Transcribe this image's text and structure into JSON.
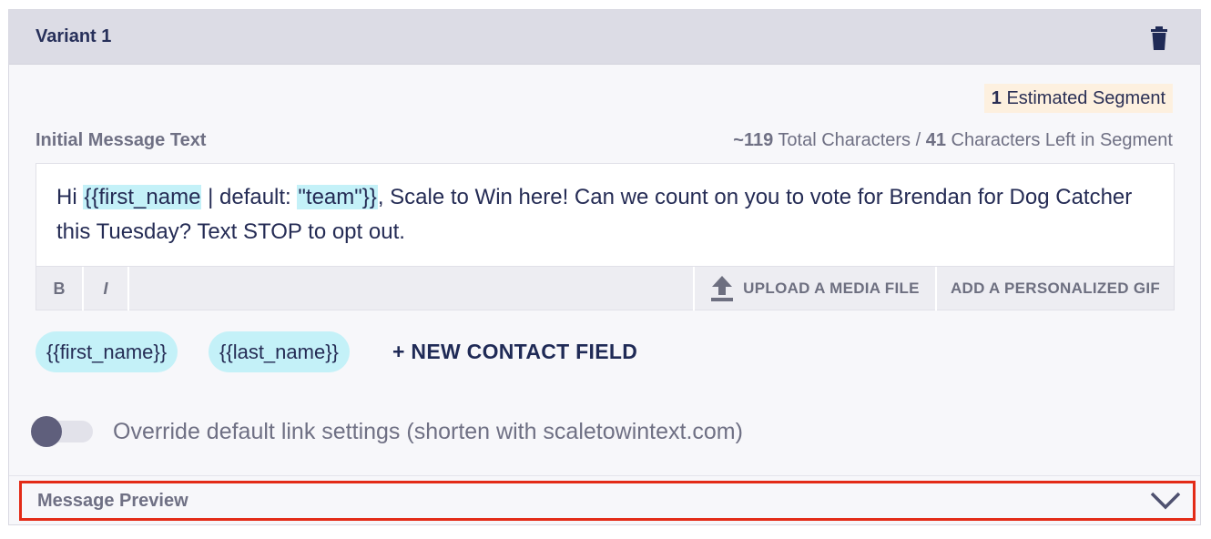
{
  "variant": {
    "title": "Variant 1",
    "delete_icon": "trash-icon"
  },
  "segment": {
    "count": "1",
    "label": "Estimated Segment"
  },
  "message": {
    "label": "Initial Message Text",
    "total_chars": "~119",
    "total_chars_label": "Total Characters /",
    "chars_left": "41",
    "chars_left_label": "Characters Left in Segment",
    "text_before": "Hi ",
    "tag_first_name": "{{first_name",
    "tag_mid": " | default: ",
    "tag_default": "\"team\"}}",
    "text_after": ", Scale to Win here! Can we count on you to vote for Brendan for Dog Catcher this Tuesday? Text STOP to opt out."
  },
  "toolbar": {
    "bold": "B",
    "italic": "I",
    "upload_icon": "upload-icon",
    "upload": "UPLOAD A MEDIA FILE",
    "gif": "ADD A PERSONALIZED GIF"
  },
  "fields": {
    "chips": [
      "{{first_name}}",
      "{{last_name}}"
    ],
    "new_field": "+ NEW CONTACT FIELD"
  },
  "link_settings": {
    "toggle_on": false,
    "label": "Override default link settings (shorten with scaletowintext.com)"
  },
  "preview": {
    "label": "Message Preview",
    "chevron_icon": "chevron-down-icon"
  },
  "colors": {
    "tag_bg": "#c4f1f8",
    "header_bg": "#dcdce5",
    "segment_bg": "#fdf0df",
    "highlight": "#e32b17"
  }
}
